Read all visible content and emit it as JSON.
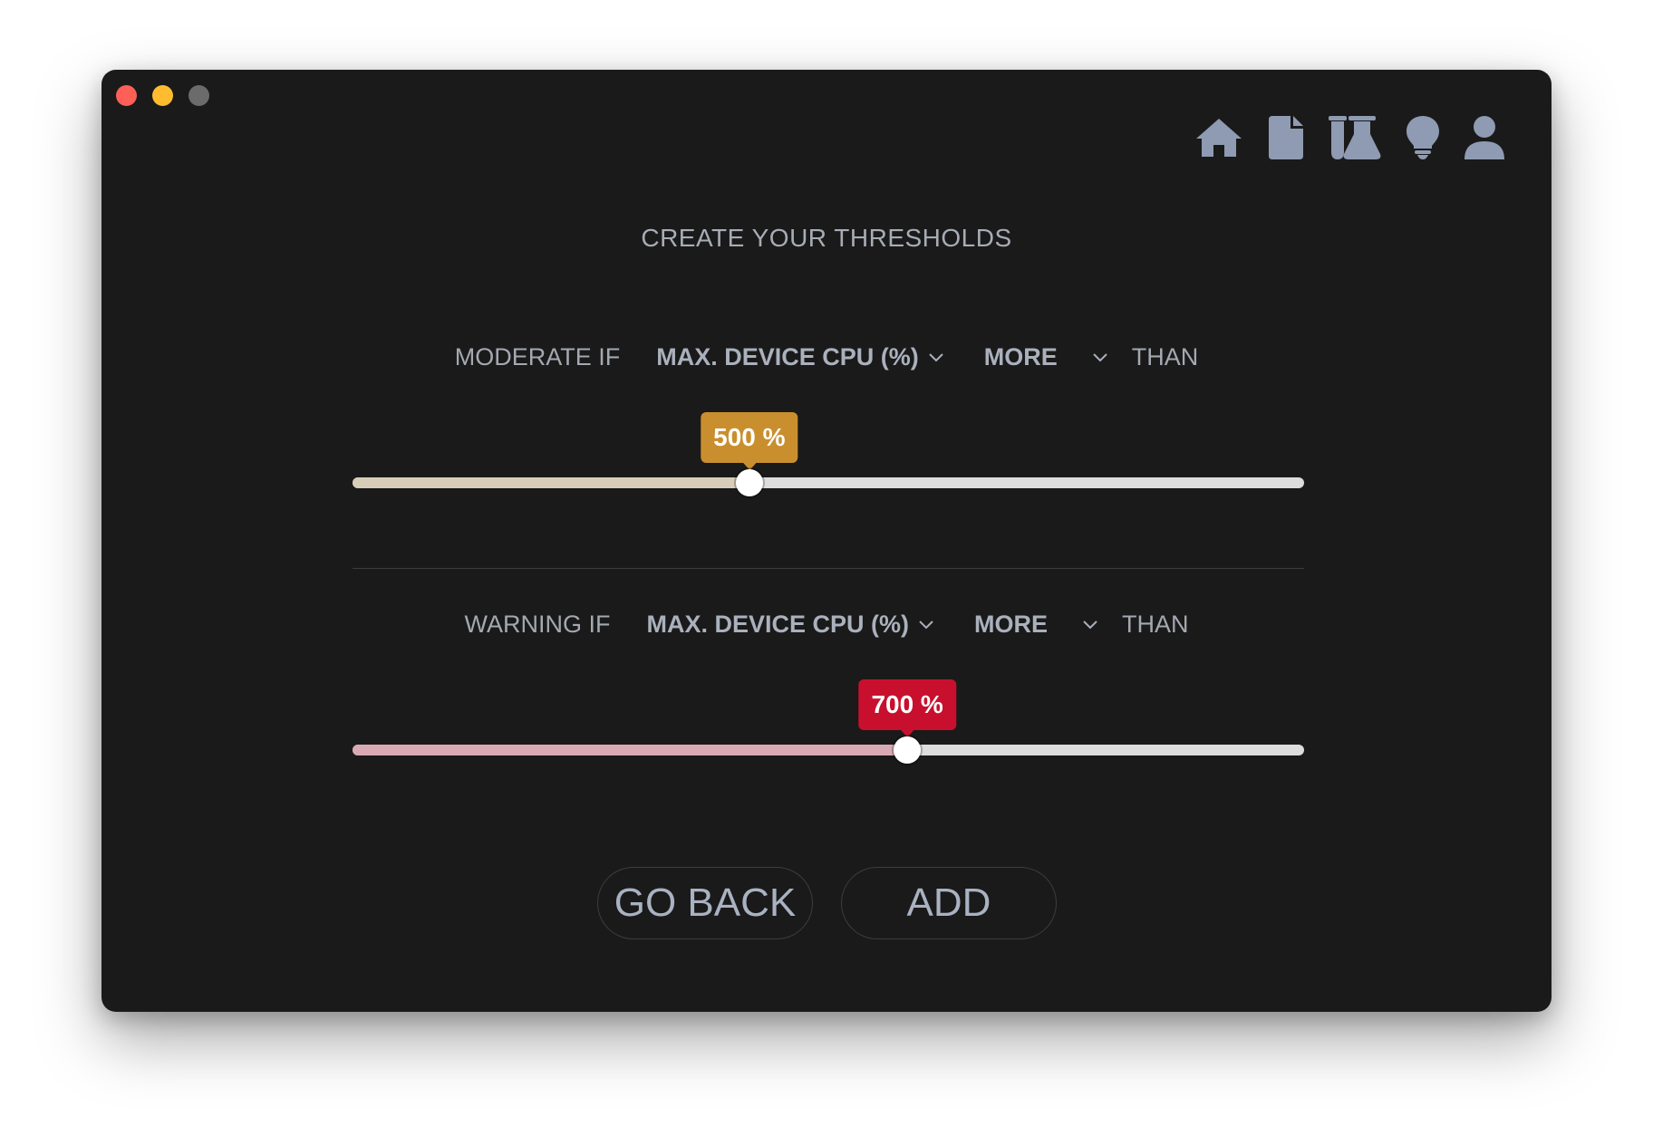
{
  "window": {
    "controls": [
      "close",
      "minimize",
      "maximize"
    ]
  },
  "nav": {
    "icons": [
      "home-icon",
      "document-icon",
      "lab-icon",
      "lightbulb-icon",
      "user-icon"
    ]
  },
  "title": "CREATE YOUR THRESHOLDS",
  "moderate": {
    "label": "MODERATE IF",
    "metric": "MAX. DEVICE CPU (%)",
    "direction": "MORE",
    "than": "THAN",
    "value_label": "500 %",
    "value_fraction": 0.417,
    "color": "#c98f2e",
    "fill_color": "#d8cdb8"
  },
  "warning": {
    "label": "WARNING IF",
    "metric": "MAX. DEVICE CPU (%)",
    "direction": "MORE",
    "than": "THAN",
    "value_label": "700 %",
    "value_fraction": 0.583,
    "color": "#c8102e",
    "fill_color": "#d9a9b4"
  },
  "buttons": {
    "back": "GO BACK",
    "add": "ADD"
  }
}
